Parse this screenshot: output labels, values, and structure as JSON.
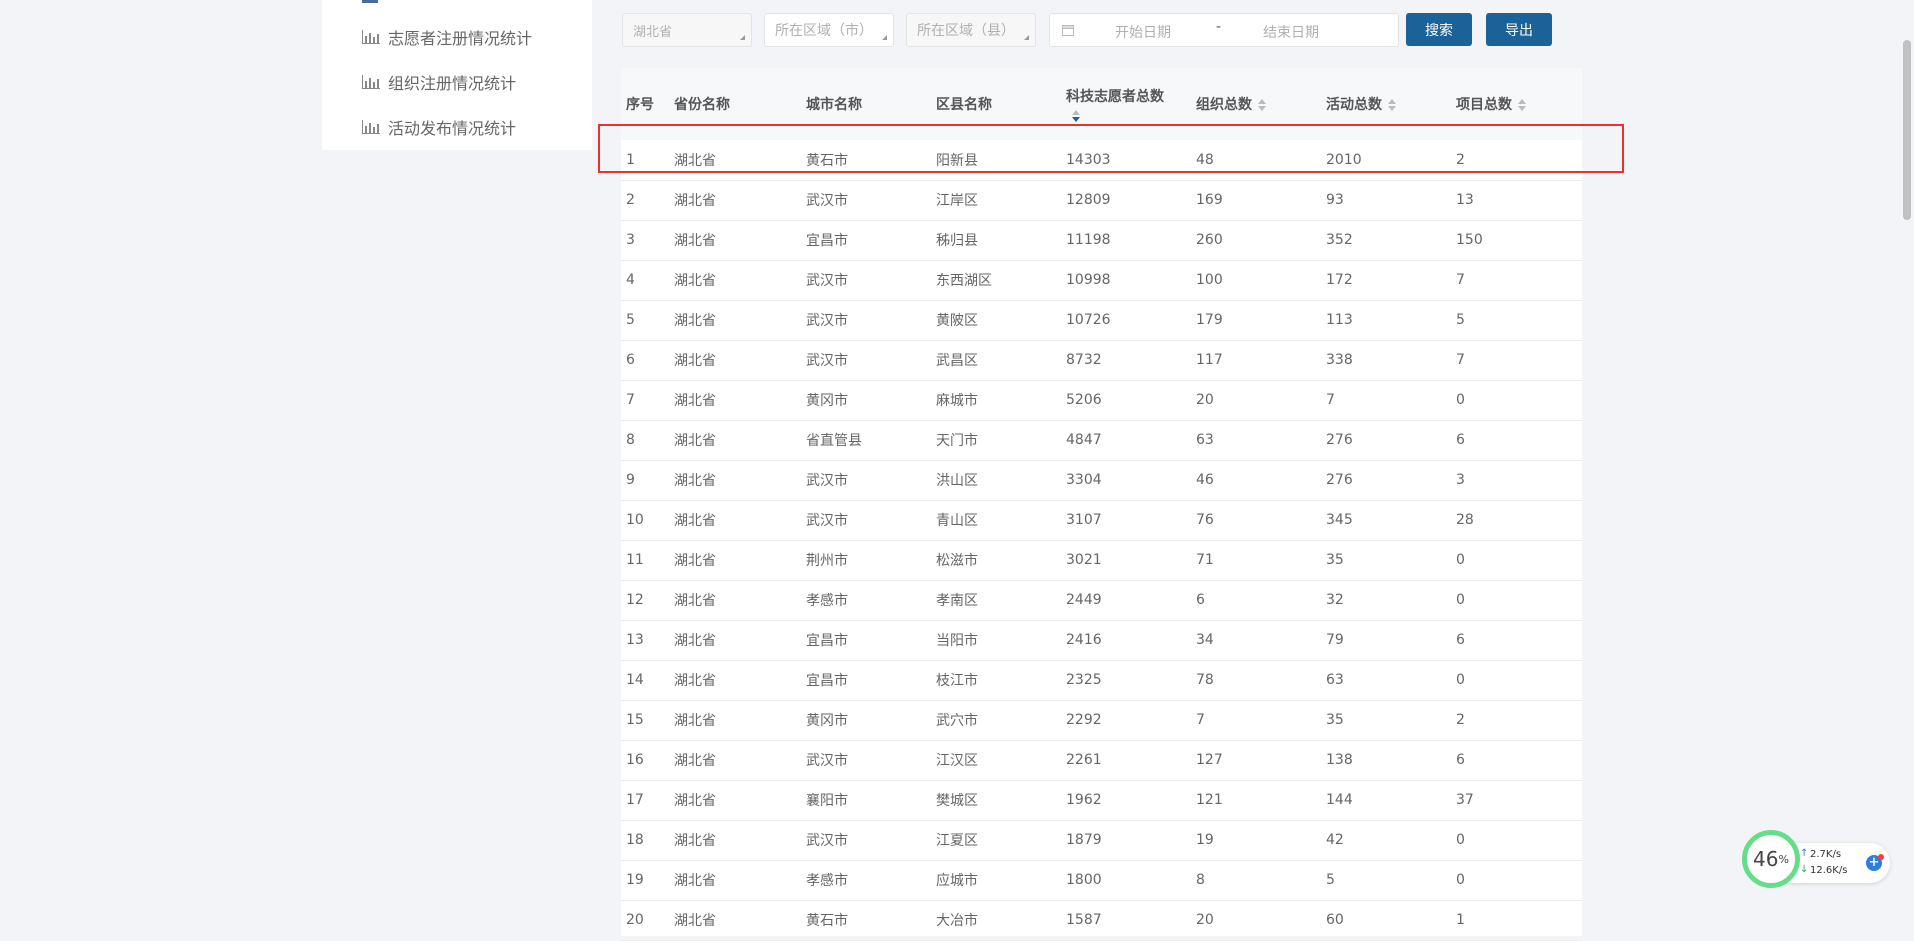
{
  "sidebar": {
    "items": [
      {
        "label": "志愿者注册情况统计",
        "icon": "bar-chart-icon"
      },
      {
        "label": "组织注册情况统计",
        "icon": "bar-chart-icon"
      },
      {
        "label": "活动发布情况统计",
        "icon": "bar-chart-icon"
      }
    ]
  },
  "filters": {
    "province": "湖北省",
    "city_placeholder": "所在区域（市）",
    "county_placeholder": "所在区域（县）",
    "start_date_placeholder": "开始日期",
    "separator": "-",
    "end_date_placeholder": "结束日期",
    "search_label": "搜索",
    "export_label": "导出"
  },
  "table": {
    "headers": {
      "index": "序号",
      "province": "省份名称",
      "city": "城市名称",
      "county": "区县名称",
      "volunteers": "科技志愿者总数",
      "orgs": "组织总数",
      "activities": "活动总数",
      "projects": "项目总数"
    },
    "rows": [
      [
        "1",
        "湖北省",
        "黄石市",
        "阳新县",
        "14303",
        "48",
        "2010",
        "2"
      ],
      [
        "2",
        "湖北省",
        "武汉市",
        "江岸区",
        "12809",
        "169",
        "93",
        "13"
      ],
      [
        "3",
        "湖北省",
        "宜昌市",
        "秭归县",
        "11198",
        "260",
        "352",
        "150"
      ],
      [
        "4",
        "湖北省",
        "武汉市",
        "东西湖区",
        "10998",
        "100",
        "172",
        "7"
      ],
      [
        "5",
        "湖北省",
        "武汉市",
        "黄陂区",
        "10726",
        "179",
        "113",
        "5"
      ],
      [
        "6",
        "湖北省",
        "武汉市",
        "武昌区",
        "8732",
        "117",
        "338",
        "7"
      ],
      [
        "7",
        "湖北省",
        "黄冈市",
        "麻城市",
        "5206",
        "20",
        "7",
        "0"
      ],
      [
        "8",
        "湖北省",
        "省直管县",
        "天门市",
        "4847",
        "63",
        "276",
        "6"
      ],
      [
        "9",
        "湖北省",
        "武汉市",
        "洪山区",
        "3304",
        "46",
        "276",
        "3"
      ],
      [
        "10",
        "湖北省",
        "武汉市",
        "青山区",
        "3107",
        "76",
        "345",
        "28"
      ],
      [
        "11",
        "湖北省",
        "荆州市",
        "松滋市",
        "3021",
        "71",
        "35",
        "0"
      ],
      [
        "12",
        "湖北省",
        "孝感市",
        "孝南区",
        "2449",
        "6",
        "32",
        "0"
      ],
      [
        "13",
        "湖北省",
        "宜昌市",
        "当阳市",
        "2416",
        "34",
        "79",
        "6"
      ],
      [
        "14",
        "湖北省",
        "宜昌市",
        "枝江市",
        "2325",
        "78",
        "63",
        "0"
      ],
      [
        "15",
        "湖北省",
        "黄冈市",
        "武穴市",
        "2292",
        "7",
        "35",
        "2"
      ],
      [
        "16",
        "湖北省",
        "武汉市",
        "江汉区",
        "2261",
        "127",
        "138",
        "6"
      ],
      [
        "17",
        "湖北省",
        "襄阳市",
        "樊城区",
        "1962",
        "121",
        "144",
        "37"
      ],
      [
        "18",
        "湖北省",
        "武汉市",
        "江夏区",
        "1879",
        "19",
        "42",
        "0"
      ],
      [
        "19",
        "湖北省",
        "孝感市",
        "应城市",
        "1800",
        "8",
        "5",
        "0"
      ],
      [
        "20",
        "湖北省",
        "黄石市",
        "大冶市",
        "1587",
        "20",
        "60",
        "1"
      ]
    ]
  },
  "widget": {
    "percent": "46",
    "percent_unit": "%",
    "upload": "2.7K/s",
    "download": "12.6K/s"
  },
  "colors": {
    "accent": "#1a6298",
    "highlight": "#e8332b",
    "ring": "#66dd88"
  }
}
